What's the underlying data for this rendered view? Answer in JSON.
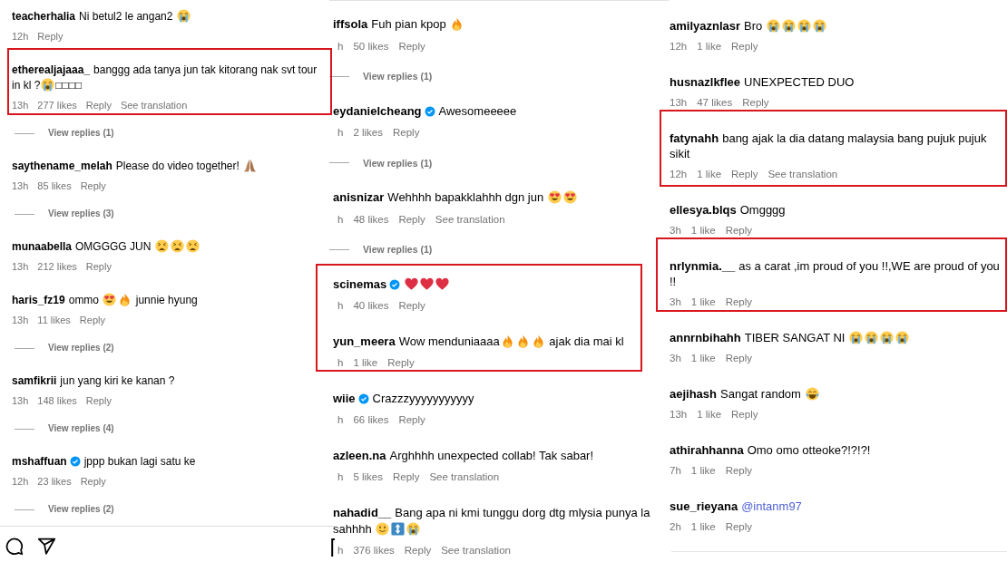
{
  "panels": [
    {
      "items": [
        {
          "kind": "comment",
          "username": "teacherhalia",
          "verified": false,
          "body": [
            {
              "kind": "text",
              "text": "Ni betul2 le angan2 "
            },
            {
              "kind": "crying-face"
            }
          ],
          "time": "12h",
          "reply": "Reply"
        },
        {
          "kind": "highlight",
          "comments": [
            {
              "username": "etherealjajaaa_",
              "verified": false,
              "body": [
                {
                  "kind": "text",
                  "text": "banggg ada tanya jun tak kitorang nak svt tour in kl ?"
                },
                {
                  "kind": "crying-face"
                },
                {
                  "kind": "text",
                  "text": "□□□□"
                }
              ],
              "time": "13h",
              "likes": "277 likes",
              "reply": "Reply",
              "translate": "See translation"
            }
          ]
        },
        {
          "kind": "replies",
          "label": "View replies (1)"
        },
        {
          "kind": "comment",
          "username": "saythename_melah",
          "verified": false,
          "body": [
            {
              "kind": "text",
              "text": "Please do video together! "
            },
            {
              "kind": "praying-hands"
            }
          ],
          "time": "13h",
          "likes": "85 likes",
          "reply": "Reply"
        },
        {
          "kind": "replies",
          "label": "View replies (3)"
        },
        {
          "kind": "comment",
          "username": "munaabella",
          "verified": false,
          "body": [
            {
              "kind": "text",
              "text": "OMGGGG JUN "
            },
            {
              "kind": "weary-face"
            },
            {
              "kind": "weary-face"
            },
            {
              "kind": "weary-face"
            }
          ],
          "time": "13h",
          "likes": "212 likes",
          "reply": "Reply"
        },
        {
          "kind": "comment",
          "username": "haris_fz19",
          "verified": false,
          "body": [
            {
              "kind": "text",
              "text": "ommo "
            },
            {
              "kind": "heart-eyes"
            },
            {
              "kind": "fire"
            },
            {
              "kind": "text",
              "text": " junnie hyung"
            }
          ],
          "time": "13h",
          "likes": "11 likes",
          "reply": "Reply"
        },
        {
          "kind": "replies",
          "label": "View replies (2)"
        },
        {
          "kind": "comment",
          "username": "samfikrii",
          "verified": false,
          "body": [
            {
              "kind": "text",
              "text": "jun yang kiri ke kanan ?"
            }
          ],
          "time": "13h",
          "likes": "148 likes",
          "reply": "Reply"
        },
        {
          "kind": "replies",
          "label": "View replies (4)"
        },
        {
          "kind": "comment",
          "username": "mshaffuan",
          "verified": true,
          "body": [
            {
              "kind": "text",
              "text": "jppp bukan lagi satu ke"
            }
          ],
          "time": "12h",
          "likes": "23 likes",
          "reply": "Reply"
        },
        {
          "kind": "replies",
          "label": "View replies (2)"
        }
      ]
    },
    {
      "items": [
        {
          "kind": "comment",
          "username": "iffsola",
          "verified": false,
          "body": [
            {
              "kind": "text",
              "text": "Fuh pian kpop "
            },
            {
              "kind": "fire"
            }
          ],
          "time": "h",
          "likes": "50 likes",
          "reply": "Reply"
        },
        {
          "kind": "replies",
          "label": "View replies (1)"
        },
        {
          "kind": "comment",
          "username": "eydanielcheang",
          "verified": true,
          "body": [
            {
              "kind": "text",
              "text": "Awesomeeeee"
            }
          ],
          "time": "h",
          "likes": "2 likes",
          "reply": "Reply"
        },
        {
          "kind": "replies",
          "label": "View replies (1)"
        },
        {
          "kind": "comment",
          "username": "anisnizar",
          "verified": false,
          "body": [
            {
              "kind": "text",
              "text": "Wehhhh bapakklahhh dgn jun "
            },
            {
              "kind": "heart-eyes"
            },
            {
              "kind": "heart-eyes"
            }
          ],
          "time": "h",
          "likes": "48 likes",
          "reply": "Reply",
          "translate": "See translation"
        },
        {
          "kind": "replies",
          "label": "View replies (1)"
        },
        {
          "kind": "highlight",
          "comments": [
            {
              "username": "scinemas",
              "verified": true,
              "body": [
                {
                  "kind": "red-heart"
                },
                {
                  "kind": "red-heart"
                },
                {
                  "kind": "red-heart"
                }
              ],
              "time": "h",
              "likes": "40 likes",
              "reply": "Reply"
            },
            {
              "username": "yun_meera",
              "verified": false,
              "body": [
                {
                  "kind": "text",
                  "text": "Wow menduniaaaa"
                },
                {
                  "kind": "fire"
                },
                {
                  "kind": "fire"
                },
                {
                  "kind": "fire"
                },
                {
                  "kind": "text",
                  "text": " ajak dia mai kl"
                }
              ],
              "time": "h",
              "likes": "1 like",
              "reply": "Reply"
            }
          ]
        },
        {
          "kind": "comment",
          "username": "wiie",
          "verified": true,
          "body": [
            {
              "kind": "text",
              "text": "Crazzzyyyyyyyyyyy"
            }
          ],
          "time": "h",
          "likes": "66 likes",
          "reply": "Reply"
        },
        {
          "kind": "comment",
          "username": "azleen.na",
          "verified": false,
          "body": [
            {
              "kind": "text",
              "text": "Arghhhh unexpected collab! Tak sabar!"
            }
          ],
          "time": "h",
          "likes": "5 likes",
          "reply": "Reply",
          "translate": "See translation"
        },
        {
          "kind": "comment",
          "username": "nahadid__",
          "verified": false,
          "body": [
            {
              "kind": "text",
              "text": "Bang apa ni kmi tunggu dorg dtg mlysia punya la sahhhh "
            },
            {
              "kind": "slight-smile"
            },
            {
              "kind": "arrow-square"
            },
            {
              "kind": "crying-face"
            }
          ],
          "time": "h",
          "likes": "376 likes",
          "reply": "Reply",
          "translate": "See translation"
        }
      ]
    },
    {
      "items": [
        {
          "kind": "comment",
          "username": "amilyaznlasr",
          "verified": false,
          "body": [
            {
              "kind": "text",
              "text": "Bro "
            },
            {
              "kind": "crying-face"
            },
            {
              "kind": "crying-face"
            },
            {
              "kind": "crying-face"
            },
            {
              "kind": "crying-face"
            }
          ],
          "time": "12h",
          "likes": "1 like",
          "reply": "Reply"
        },
        {
          "kind": "comment",
          "username": "husnazlkflee",
          "verified": false,
          "body": [
            {
              "kind": "text",
              "text": "UNEXPECTED DUO"
            }
          ],
          "time": "13h",
          "likes": "47 likes",
          "reply": "Reply"
        },
        {
          "kind": "highlight",
          "comments": [
            {
              "username": "fatynahh",
              "verified": false,
              "body": [
                {
                  "kind": "text",
                  "text": "bang ajak la dia datang malaysia bang pujuk pujuk sikit"
                }
              ],
              "time": "12h",
              "likes": "1 like",
              "reply": "Reply",
              "translate": "See translation"
            }
          ]
        },
        {
          "kind": "comment",
          "username": "ellesya.blqs",
          "verified": false,
          "body": [
            {
              "kind": "text",
              "text": "Omgggg"
            }
          ],
          "time": "3h",
          "likes": "1 like",
          "reply": "Reply"
        },
        {
          "kind": "highlight",
          "comments": [
            {
              "username": "nrlynmia.__",
              "verified": false,
              "body": [
                {
                  "kind": "text",
                  "text": "as a carat ,im proud of you !!,WE are proud of you !!"
                }
              ],
              "time": "3h",
              "likes": "1 like",
              "reply": "Reply"
            }
          ]
        },
        {
          "kind": "comment",
          "username": "annrnbihahh",
          "verified": false,
          "body": [
            {
              "kind": "text",
              "text": "TIBER SANGAT NI "
            },
            {
              "kind": "crying-face"
            },
            {
              "kind": "crying-face"
            },
            {
              "kind": "crying-face"
            },
            {
              "kind": "crying-face"
            }
          ],
          "time": "3h",
          "likes": "1 like",
          "reply": "Reply"
        },
        {
          "kind": "comment",
          "username": "aejihash",
          "verified": false,
          "body": [
            {
              "kind": "text",
              "text": "Sangat random "
            },
            {
              "kind": "laughing-face"
            }
          ],
          "time": "13h",
          "likes": "1 like",
          "reply": "Reply"
        },
        {
          "kind": "comment",
          "username": "athirahhanna",
          "verified": false,
          "body": [
            {
              "kind": "text",
              "text": "Omo omo otteoke?!?!?!"
            }
          ],
          "time": "7h",
          "likes": "1 like",
          "reply": "Reply"
        },
        {
          "kind": "comment",
          "username": "sue_rieyana",
          "verified": false,
          "body": [
            {
              "kind": "mention",
              "text": "@intanm97"
            }
          ],
          "time": "2h",
          "likes": "1 like",
          "reply": "Reply"
        }
      ]
    }
  ]
}
